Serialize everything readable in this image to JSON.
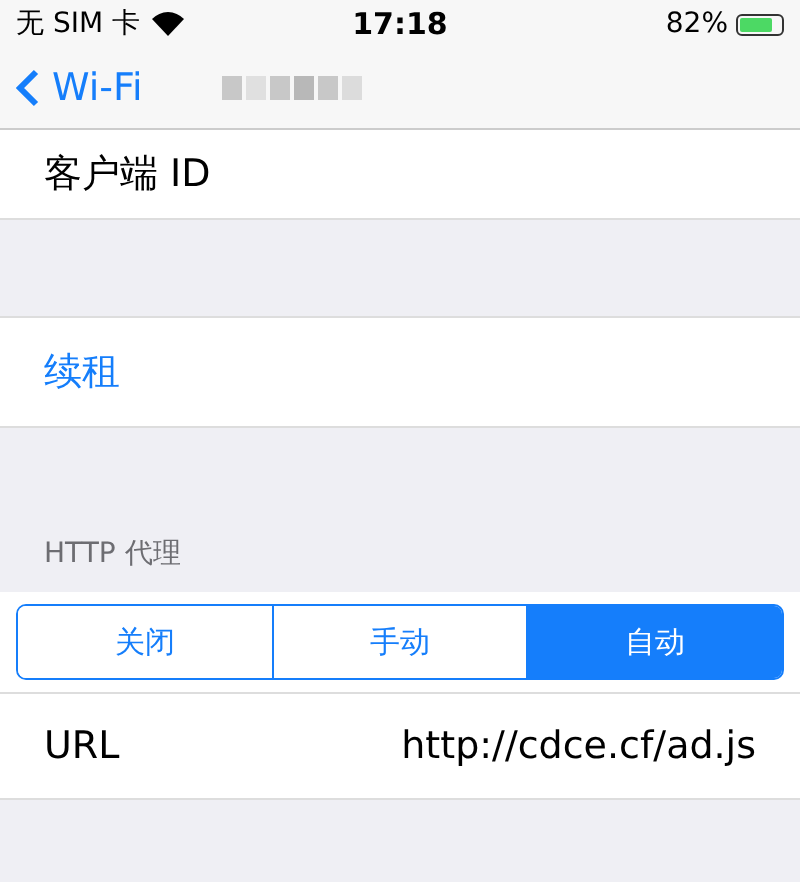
{
  "status_bar": {
    "carrier": "无 SIM 卡",
    "time": "17:18",
    "battery": "82%"
  },
  "nav": {
    "back": "Wi-Fi"
  },
  "rows_top": [
    {
      "label": "客户端 ID"
    }
  ],
  "renew": {
    "label": "续租"
  },
  "proxy": {
    "header": "HTTP 代理",
    "segments": [
      {
        "label": "关闭",
        "selected": false
      },
      {
        "label": "手动",
        "selected": false
      },
      {
        "label": "自动",
        "selected": true
      }
    ],
    "url_label": "URL",
    "url_value": "http://cdce.cf/ad.js"
  }
}
